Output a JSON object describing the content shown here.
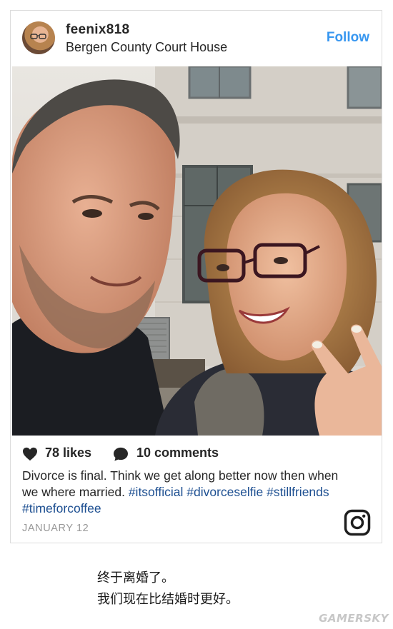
{
  "post": {
    "username": "feenix818",
    "location": "Bergen County Court House",
    "follow_label": "Follow",
    "likes": "78 likes",
    "comments": "10 comments",
    "caption_text_1": "Divorce is final. Think we get along better now then when we where married.",
    "hashtags": [
      "#itsofficial",
      "#divorceselfie",
      "#stillfriends",
      "#timeforcoffee"
    ],
    "date": "JANUARY 12"
  },
  "subtitle": {
    "line1": "终于离婚了。",
    "line2": "我们现在比结婚时更好。"
  },
  "watermark": "GAMERSKY",
  "colors": {
    "follow": "#3897f0",
    "hashtag": "#1d4f91",
    "text": "#262626",
    "date": "#999999"
  },
  "icons": [
    "heart-icon",
    "comment-icon",
    "instagram-icon"
  ]
}
